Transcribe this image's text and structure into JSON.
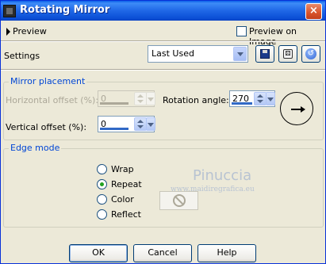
{
  "window": {
    "title": "Rotating Mirror",
    "close_glyph": "×"
  },
  "preview": {
    "label": "Preview",
    "preview_on_image_label": "Preview on Image",
    "preview_on_image_checked": false
  },
  "settings": {
    "label": "Settings",
    "preset_value": "Last Used"
  },
  "mirror_placement": {
    "title": "Mirror placement",
    "horizontal_offset_label": "Horizontal offset (%):",
    "horizontal_offset_value": "0",
    "vertical_offset_label": "Vertical offset (%):",
    "vertical_offset_value": "0",
    "rotation_angle_label": "Rotation angle:",
    "rotation_angle_value": "270"
  },
  "edge_mode": {
    "title": "Edge mode",
    "options": [
      {
        "label": "Wrap",
        "checked": false
      },
      {
        "label": "Repeat",
        "checked": true
      },
      {
        "label": "Color",
        "checked": false
      },
      {
        "label": "Reflect",
        "checked": false
      }
    ]
  },
  "watermark": {
    "name": "Pinuccia",
    "url": "www.maidiregrafica.eu"
  },
  "buttons": {
    "ok": "OK",
    "cancel": "Cancel",
    "help": "Help"
  },
  "icons": {
    "app": "app-icon",
    "close": "close-icon",
    "save": "save-preset-icon",
    "random": "dice-icon",
    "reset": "reset-icon",
    "angle": "angle-dial-icon",
    "no_color": "no-color-icon"
  },
  "colors": {
    "title_bar": "#0b4fd6",
    "group_title": "#0046d5",
    "dialog_bg": "#ece9d8",
    "checked_radio": "#21a121"
  }
}
